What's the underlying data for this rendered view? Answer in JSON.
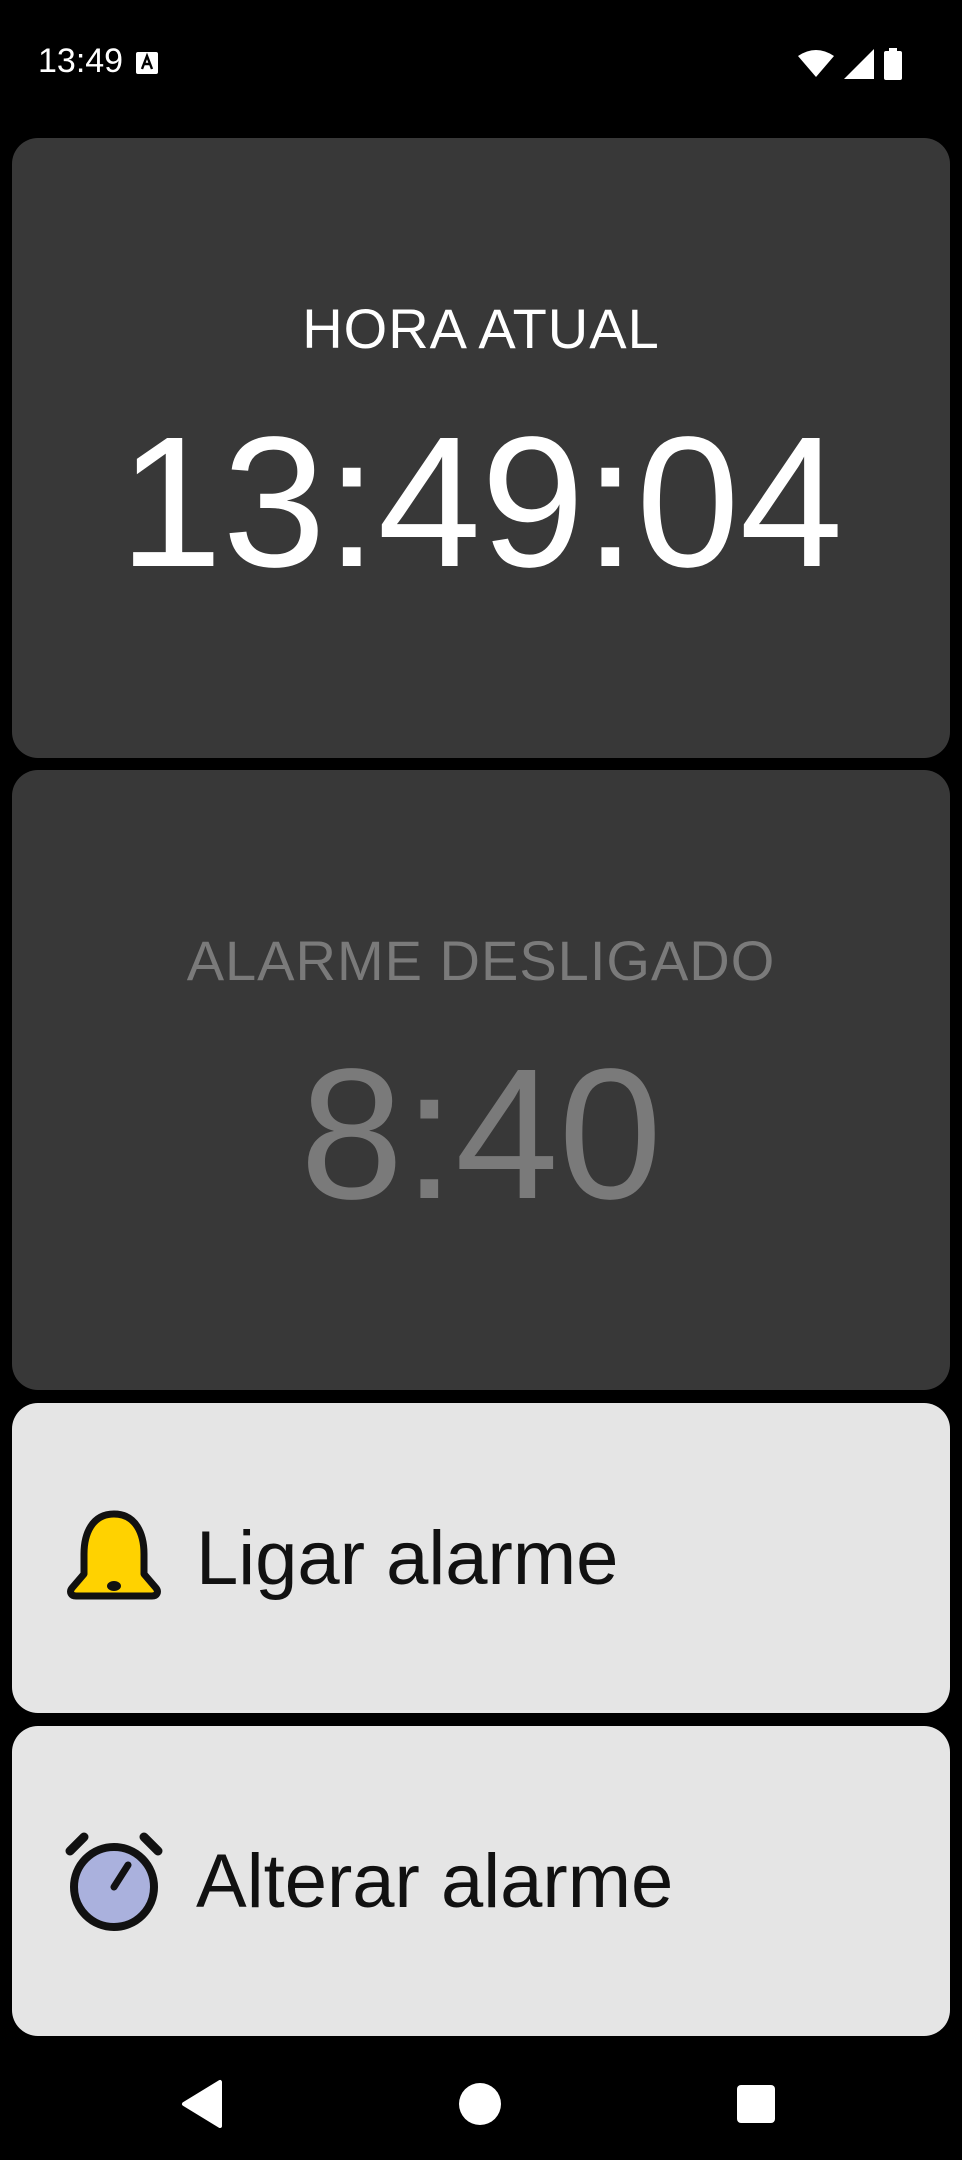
{
  "status_bar": {
    "time": "13:49",
    "icons": [
      "app-notification-icon",
      "wifi-icon",
      "signal-icon",
      "battery-icon"
    ]
  },
  "clock": {
    "caption": "HORA ATUAL",
    "time": "13:49:04"
  },
  "alarm": {
    "caption": "ALARME DESLIGADO",
    "time": "8:40"
  },
  "actions": {
    "toggle_label": "Ligar alarme",
    "toggle_icon": "bell-icon",
    "change_label": "Alterar alarme",
    "change_icon": "alarm-clock-icon"
  },
  "navigation": {
    "icons": [
      "back-icon",
      "home-icon",
      "recents-icon"
    ]
  },
  "colors": {
    "background": "#000000",
    "card_dark": "#383838",
    "card_light": "#e5e5e5",
    "text_primary": "#ffffff",
    "text_disabled": "#7a7a7a",
    "bell": "#ffd200",
    "clock_face": "#aab1dd"
  }
}
